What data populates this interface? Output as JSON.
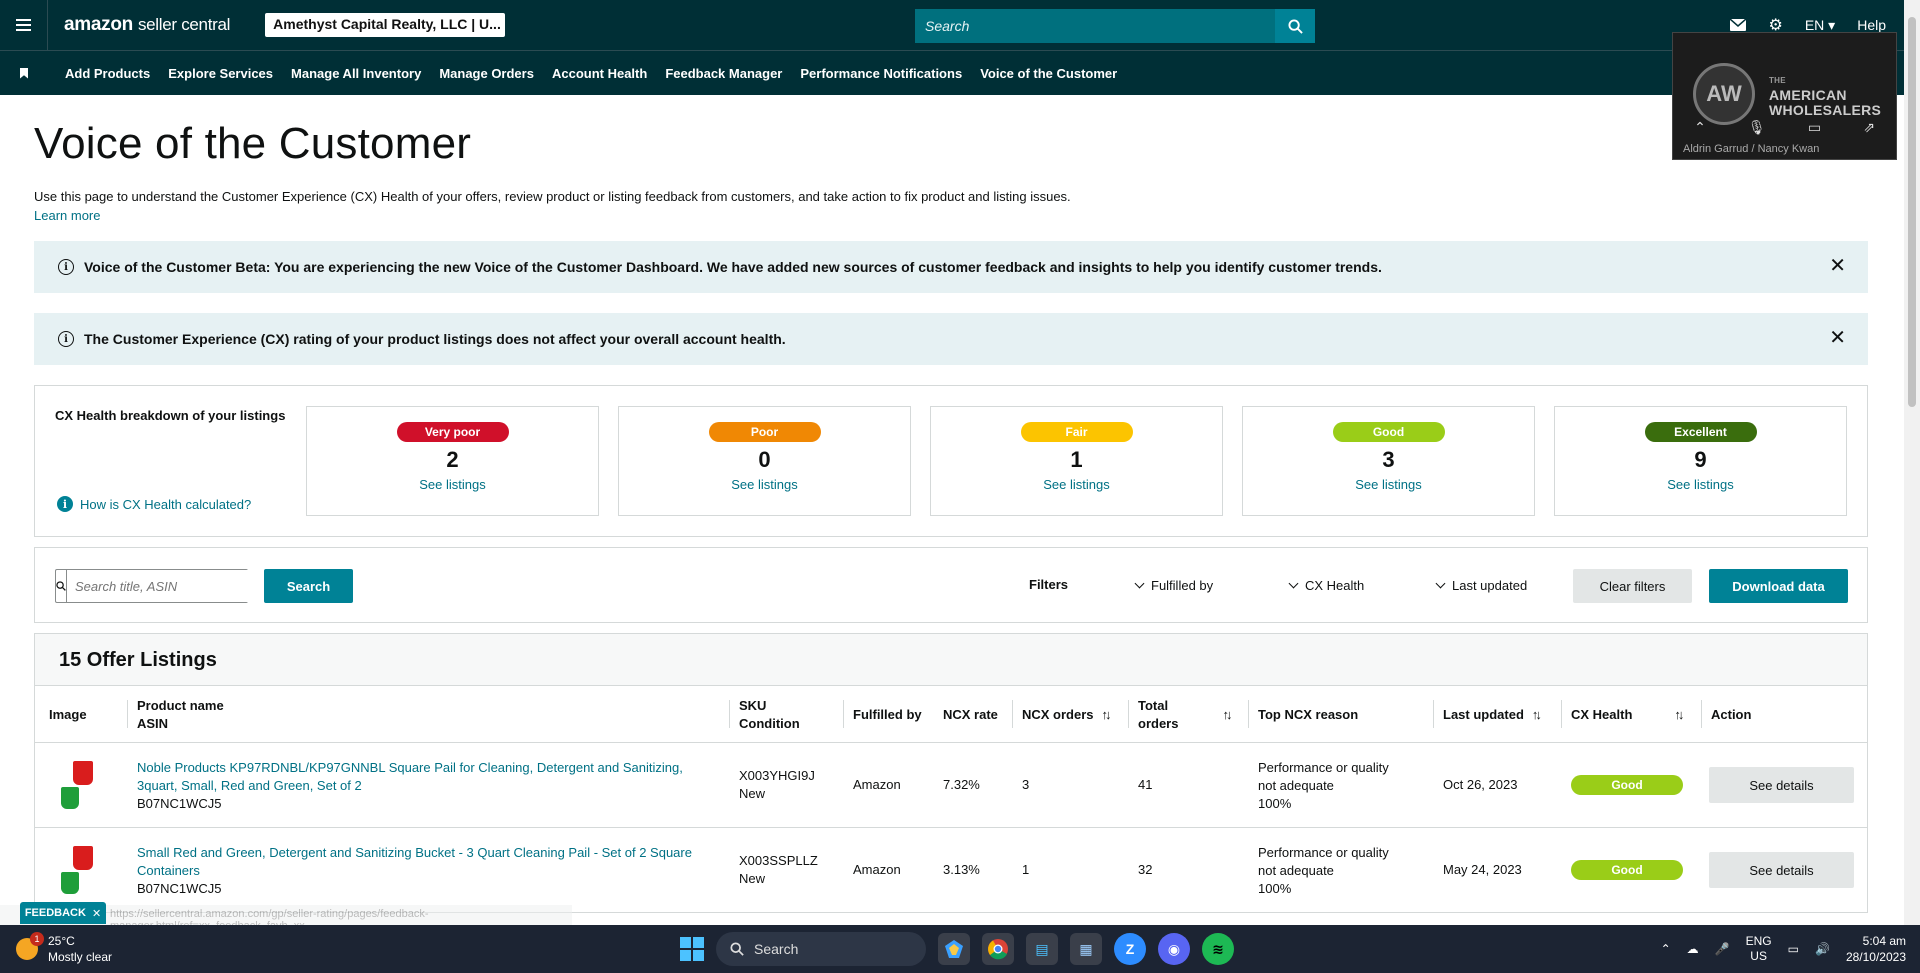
{
  "topbar": {
    "logo_amazon": "amazon",
    "logo_sc": "seller central",
    "account": "Amethyst Capital Realty, LLC | U...",
    "search_placeholder": "Search",
    "lang": "EN",
    "help": "Help"
  },
  "nav": {
    "items": [
      "Add Products",
      "Explore Services",
      "Manage All Inventory",
      "Manage Orders",
      "Account Health",
      "Feedback Manager",
      "Performance Notifications",
      "Voice of the Customer"
    ]
  },
  "video": {
    "logo": "AW",
    "title_small": "THE",
    "title_line1": "AMERICAN",
    "title_line2": "WHOLESALERS",
    "names": "Aldrin Garrud / Nancy Kwan"
  },
  "page": {
    "title": "Voice of the Customer",
    "description": "Use this page to understand the Customer Experience (CX) Health of your offers, review product or listing feedback from customers, and take action to fix product and listing issues.",
    "learn_more": "Learn more"
  },
  "alerts": [
    "Voice of the Customer Beta: You are experiencing the new Voice of the Customer Dashboard. We have added new sources of customer feedback and insights to help you identify customer trends.",
    "The Customer Experience (CX) rating of your product listings does not affect your overall account health."
  ],
  "cx": {
    "title": "CX Health breakdown of your listings",
    "how": "How is CX Health calculated?",
    "cards": [
      {
        "label": "Very poor",
        "count": "2",
        "link": "See listings",
        "color": "#d0102a"
      },
      {
        "label": "Poor",
        "count": "0",
        "link": "See listings",
        "color": "#f08804"
      },
      {
        "label": "Fair",
        "count": "1",
        "link": "See listings",
        "color": "#fcc400"
      },
      {
        "label": "Good",
        "count": "3",
        "link": "See listings",
        "color": "#9acd18"
      },
      {
        "label": "Excellent",
        "count": "9",
        "link": "See listings",
        "color": "#3a6d0d"
      }
    ]
  },
  "filters": {
    "search_placeholder": "Search title, ASIN",
    "search_button": "Search",
    "label": "Filters",
    "fulfilled_by": "Fulfilled by",
    "cx_health": "CX Health",
    "last_updated": "Last updated",
    "clear": "Clear filters",
    "download": "Download data"
  },
  "table": {
    "title": "15 Offer Listings",
    "headers": {
      "image": "Image",
      "product_name": "Product name",
      "asin": "ASIN",
      "sku": "SKU",
      "condition": "Condition",
      "fulfilled_by": "Fulfilled by",
      "ncx_rate": "NCX rate",
      "ncx_orders": "NCX orders",
      "total_orders_1": "Total",
      "total_orders_2": "orders",
      "top_reason": "Top NCX reason",
      "last_updated": "Last updated",
      "cx_health": "CX Health",
      "action": "Action"
    },
    "rows": [
      {
        "name": "Noble Products KP97RDNBL/KP97GNNBL Square Pail for Cleaning, Detergent and Sanitizing, 3quart, Small, Red and Green, Set of 2",
        "asin": "B07NC1WCJ5",
        "sku": "X003YHGI9J",
        "condition": "New",
        "fulfilled": "Amazon",
        "ncx_rate": "7.32%",
        "ncx_orders": "3",
        "total_orders": "41",
        "reason_1": "Performance or quality",
        "reason_2": "not adequate",
        "reason_pct": "100%",
        "updated": "Oct 26, 2023",
        "health": "Good",
        "action": "See details"
      },
      {
        "name": "Small Red and Green, Detergent and Sanitizing Bucket - 3 Quart Cleaning Pail - Set of 2 Square Containers",
        "asin": "B07NC1WCJ5",
        "sku": "X003SSPLLZ",
        "condition": "New",
        "fulfilled": "Amazon",
        "ncx_rate": "3.13%",
        "ncx_orders": "1",
        "total_orders": "32",
        "reason_1": "Performance or quality",
        "reason_2": "not adequate",
        "reason_pct": "100%",
        "updated": "May 24, 2023",
        "health": "Good",
        "action": "See details"
      }
    ]
  },
  "feedback_tab": "FEEDBACK",
  "status_url": "https://sellercentral.amazon.com/gp/seller-rating/pages/feedback-manager.html/ref=xx_feedback_favb_xx",
  "taskbar": {
    "temp": "25°C",
    "weather": "Mostly clear",
    "weather_badge": "1",
    "search": "Search",
    "lang_1": "ENG",
    "lang_2": "US",
    "time": "5:04 am",
    "date": "28/10/2023"
  }
}
